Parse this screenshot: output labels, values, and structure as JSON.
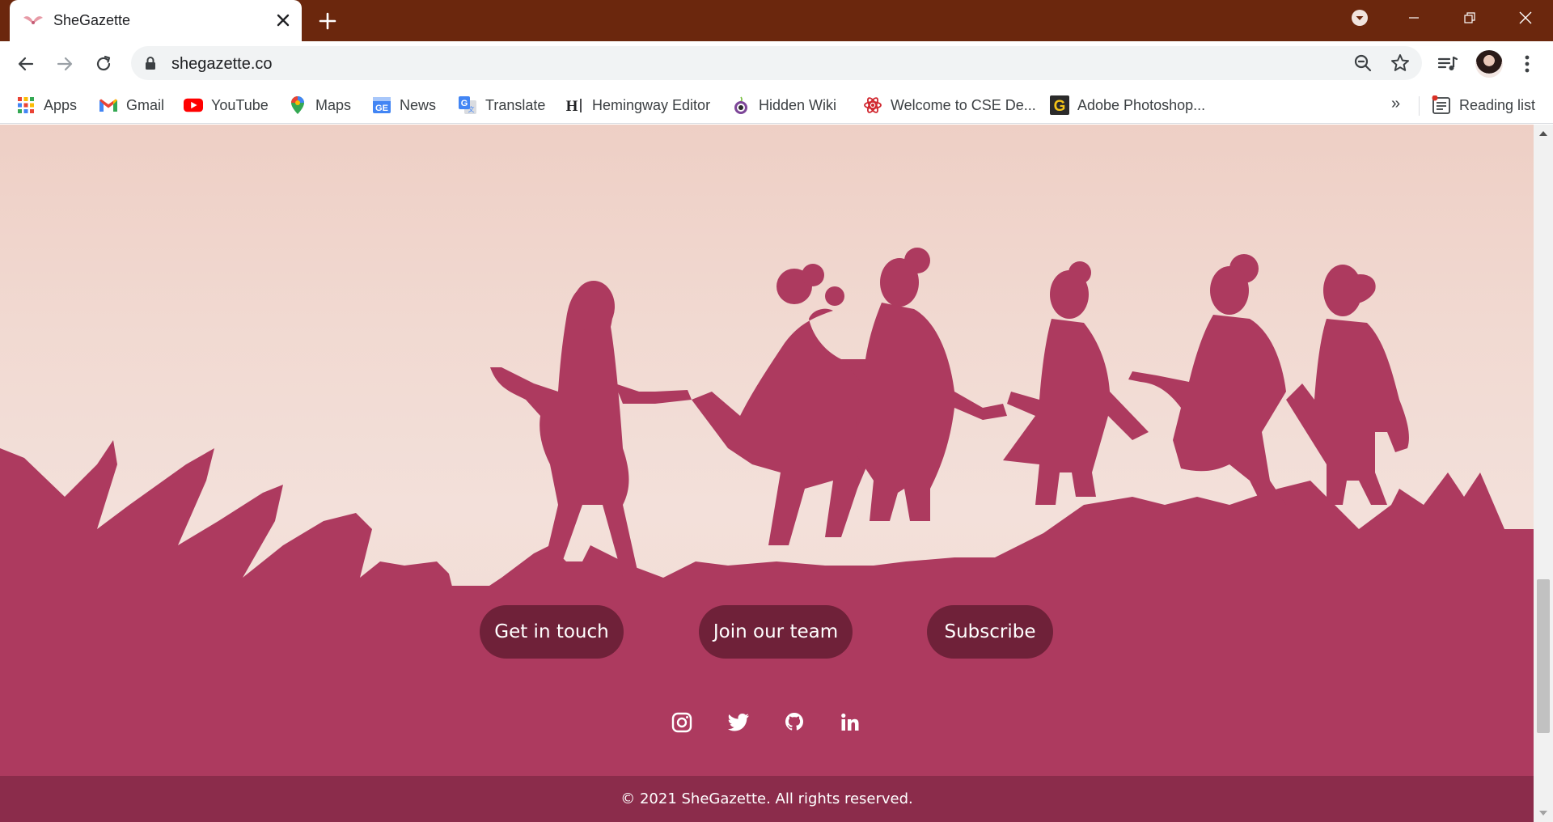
{
  "tab": {
    "title": "SheGazette"
  },
  "omnibox": {
    "url": "shegazette.co"
  },
  "bookmarks": [
    {
      "label": "Apps",
      "icon": "apps-grid-icon"
    },
    {
      "label": "Gmail",
      "icon": "gmail-icon"
    },
    {
      "label": "YouTube",
      "icon": "youtube-icon"
    },
    {
      "label": "Maps",
      "icon": "maps-pin-icon"
    },
    {
      "label": "News",
      "icon": "news-icon"
    },
    {
      "label": "Translate",
      "icon": "translate-icon"
    },
    {
      "label": "Hemingway Editor",
      "icon": "hemingway-icon"
    },
    {
      "label": "Hidden Wiki",
      "icon": "tor-onion-icon"
    },
    {
      "label": "Welcome to CSE De...",
      "icon": "atom-icon"
    },
    {
      "label": "Adobe Photoshop...",
      "icon": "photoshop-g-icon"
    }
  ],
  "bookmarks_more": "»",
  "reading_list": {
    "label": "Reading list"
  },
  "footer": {
    "buttons": [
      {
        "label": "Get in touch"
      },
      {
        "label": "Join our team"
      },
      {
        "label": "Subscribe"
      }
    ],
    "socials": [
      "instagram-icon",
      "twitter-icon",
      "github-icon",
      "linkedin-icon"
    ],
    "copyright": "© 2021 SheGazette. All rights reserved."
  },
  "colors": {
    "tabstrip": "#6b270d",
    "silhouette": "#ad3a5f",
    "button": "#6f2139",
    "copyright_bar": "#8b2c4b"
  },
  "scroll": {
    "position_fraction": 0.86
  }
}
